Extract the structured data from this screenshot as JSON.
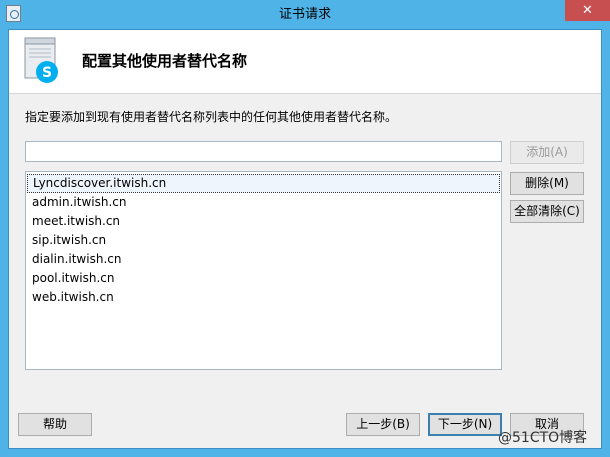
{
  "window": {
    "title": "证书请求",
    "close_glyph": "✕"
  },
  "header": {
    "icon": "skype-for-business-server-icon",
    "title": "配置其他使用者替代名称"
  },
  "instruction": "指定要添加到现有使用者替代名称列表中的任何其他使用者替代名称。",
  "name_input": {
    "value": "",
    "placeholder": ""
  },
  "buttons": {
    "add": "添加(A)",
    "delete": "删除(M)",
    "clear_all": "全部清除(C)",
    "help": "帮助",
    "back": "上一步(B)",
    "next": "下一步(N)",
    "cancel": "取消"
  },
  "san_list": {
    "items": [
      "Lyncdiscover.itwish.cn",
      "admin.itwish.cn",
      "meet.itwish.cn",
      "sip.itwish.cn",
      "dialin.itwish.cn",
      "pool.itwish.cn",
      "web.itwish.cn"
    ],
    "selected_index": 0
  },
  "watermark": "@51CTO博客",
  "colors": {
    "titlebar": "#4fb3e8",
    "close": "#c74f50",
    "skype_blue": "#00aff0"
  }
}
